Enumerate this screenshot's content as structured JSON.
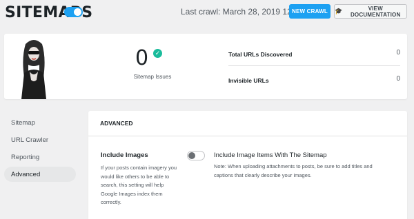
{
  "header": {
    "title": "SITEMAPS",
    "last_crawl": "Last crawl: March 28, 2019 12:22 am",
    "new_crawl_label": "NEW CRAWL",
    "view_docs_label": "VIEW DOCUMENTATION",
    "view_docs_icon": "graduation-cap-icon",
    "toggle_on": true,
    "accent_color": "#1da1f2"
  },
  "stats": {
    "issues_count": "0",
    "issues_label": "Sitemap Issues",
    "rows": [
      {
        "label": "Total URLs Discovered",
        "value": "0"
      },
      {
        "label": "Invisible URLs",
        "value": "0"
      }
    ]
  },
  "nav": {
    "items": [
      {
        "label": "Sitemap",
        "active": false
      },
      {
        "label": "URL Crawler",
        "active": false
      },
      {
        "label": "Reporting",
        "active": false
      },
      {
        "label": "Advanced",
        "active": true
      }
    ]
  },
  "panel": {
    "title": "ADVANCED",
    "setting": {
      "title": "Include Images",
      "description": "If your posts contain imagery you would like others to be able to search, this setting will help Google Images index them correctly.",
      "option_label": "Include Image Items With The Sitemap",
      "option_note": "Note: When uploading attachments to posts, be sure to add titles and captions that clearly describe your images.",
      "option_enabled": false
    }
  }
}
